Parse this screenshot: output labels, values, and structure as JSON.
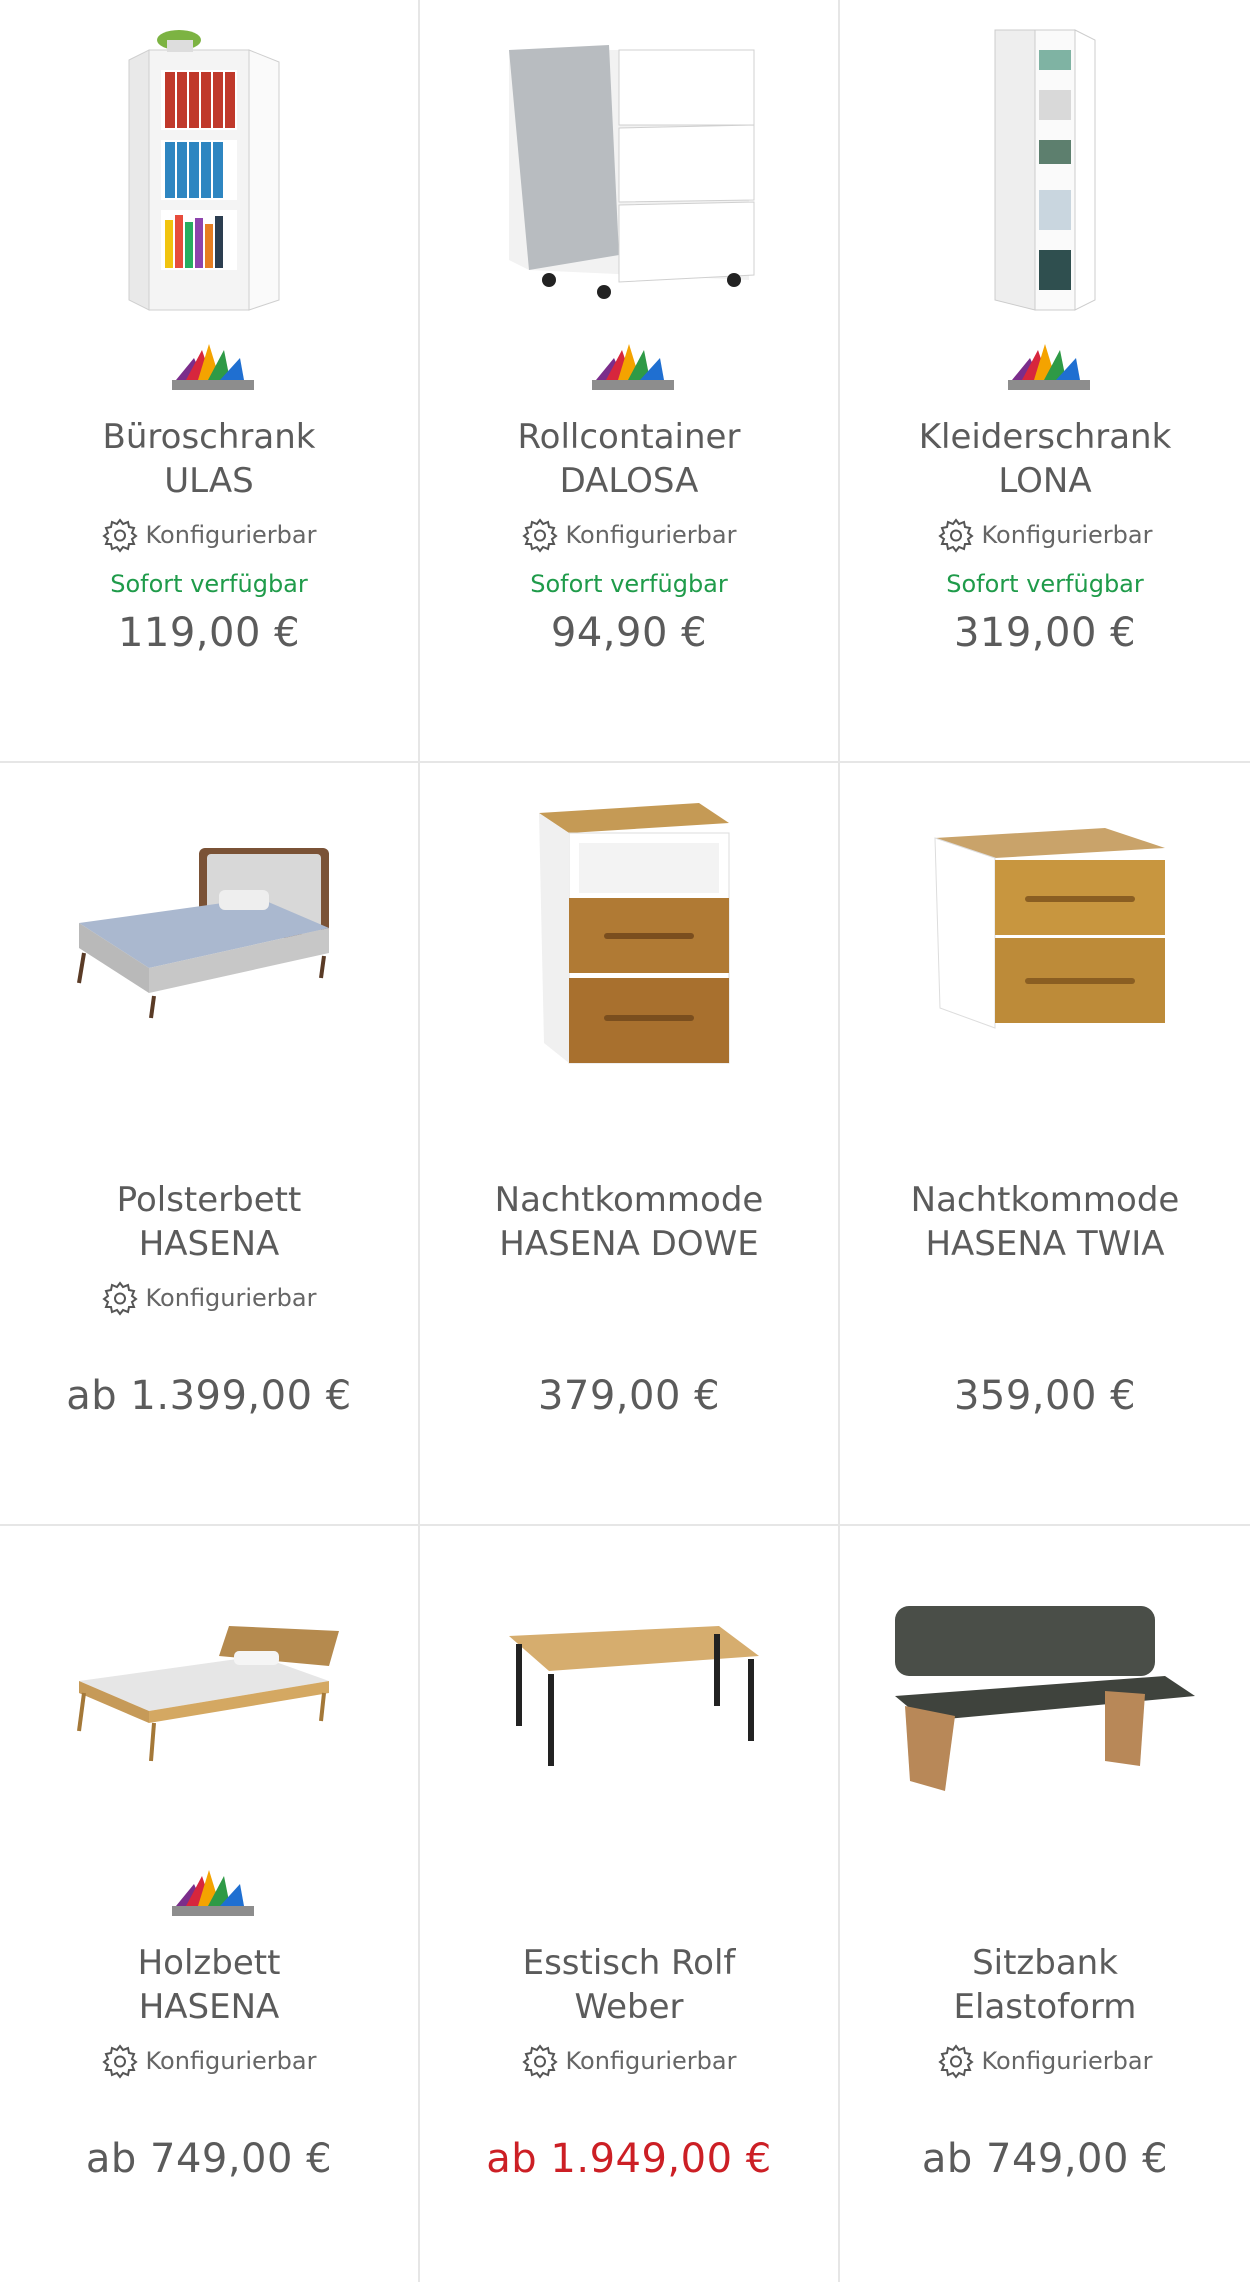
{
  "colors": {
    "text": "#5b5b5b",
    "available": "#1f9b4a",
    "sale_price": "#cc1f25",
    "divider": "#e6e6e6"
  },
  "products": [
    {
      "title1": "Büroschrank",
      "title2": "ULAS",
      "config": "Konfigurierbar",
      "availability": "Sofort verfügbar",
      "price": "119,00 €",
      "color_badge": true,
      "image": "office-cabinet"
    },
    {
      "title1": "Rollcontainer",
      "title2": "DALOSA",
      "config": "Konfigurierbar",
      "availability": "Sofort verfügbar",
      "price": "94,90 €",
      "color_badge": true,
      "image": "roll-container"
    },
    {
      "title1": "Kleiderschrank",
      "title2": "LONA",
      "config": "Konfigurierbar",
      "availability": "Sofort verfügbar",
      "price": "319,00 €",
      "color_badge": true,
      "image": "wardrobe"
    },
    {
      "title1": "Polsterbett",
      "title2": "HASENA",
      "config": "Konfigurierbar",
      "availability": "",
      "price": "ab 1.399,00 €",
      "color_badge": false,
      "image": "upholstered-bed"
    },
    {
      "title1": "Nachtkommode",
      "title2": "HASENA DOWE",
      "config": "",
      "availability": "",
      "price": "379,00 €",
      "color_badge": false,
      "image": "nightstand-open"
    },
    {
      "title1": "Nachtkommode",
      "title2": "HASENA TWIA",
      "config": "",
      "availability": "",
      "price": "359,00 €",
      "color_badge": false,
      "image": "nightstand-drawers"
    },
    {
      "title1": "Holzbett",
      "title2": "HASENA",
      "config": "Konfigurierbar",
      "availability": "",
      "price": "ab 749,00 €",
      "color_badge": true,
      "image": "wood-bed"
    },
    {
      "title1": "Esstisch Rolf",
      "title2": "Weber",
      "config": "Konfigurierbar",
      "availability": "",
      "price": "ab 1.949,00 €",
      "price_sale": true,
      "color_badge": false,
      "image": "dining-table"
    },
    {
      "title1": "Sitzbank",
      "title2": "Elastoform",
      "config": "Konfigurierbar",
      "availability": "",
      "price": "ab 749,00 €",
      "color_badge": false,
      "image": "bench"
    }
  ]
}
